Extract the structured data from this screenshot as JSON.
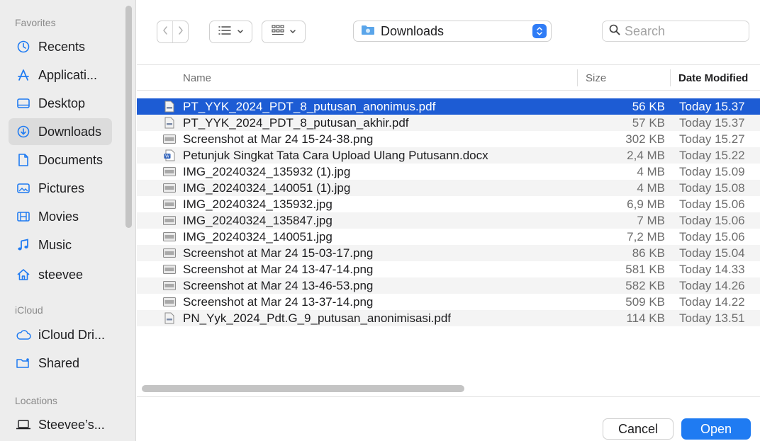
{
  "sidebar": {
    "sections": {
      "favorites": "Favorites",
      "icloud": "iCloud",
      "locations": "Locations"
    },
    "favorites": [
      {
        "label": "Recents",
        "icon": "clock-icon"
      },
      {
        "label": "Applicati...",
        "icon": "applications-icon"
      },
      {
        "label": "Desktop",
        "icon": "desktop-icon"
      },
      {
        "label": "Downloads",
        "icon": "download-icon",
        "active": true
      },
      {
        "label": "Documents",
        "icon": "document-icon"
      },
      {
        "label": "Pictures",
        "icon": "pictures-icon"
      },
      {
        "label": "Movies",
        "icon": "film-icon"
      },
      {
        "label": "Music",
        "icon": "music-note-icon"
      },
      {
        "label": "steevee",
        "icon": "home-icon"
      }
    ],
    "icloud": [
      {
        "label": "iCloud Dri...",
        "icon": "cloud-icon"
      },
      {
        "label": "Shared",
        "icon": "shared-folder-icon"
      }
    ],
    "locations": [
      {
        "label": "Steevee’s...",
        "icon": "laptop-icon"
      }
    ]
  },
  "toolbar": {
    "path_label": "Downloads",
    "search_placeholder": "Search"
  },
  "columns": {
    "name": "Name",
    "size": "Size",
    "date": "Date Modified"
  },
  "files": [
    {
      "name": "PT_YYK_2024_PDT_8_putusan_anonimus.pdf",
      "size": "56 KB",
      "date": "Today 15.37",
      "icon": "pdf-file-icon"
    },
    {
      "name": "PT_YYK_2024_PDT_8_putusan_akhir.pdf",
      "size": "57 KB",
      "date": "Today 15.37",
      "icon": "pdf-file-icon"
    },
    {
      "name": "Screenshot at Mar 24 15-24-38.png",
      "size": "302 KB",
      "date": "Today 15.27",
      "icon": "image-file-icon"
    },
    {
      "name": "Petunjuk Singkat Tata Cara Upload Ulang Putusann.docx",
      "size": "2,4 MB",
      "date": "Today 15.22",
      "icon": "word-file-icon"
    },
    {
      "name": "IMG_20240324_135932 (1).jpg",
      "size": "4 MB",
      "date": "Today 15.09",
      "icon": "image-file-icon"
    },
    {
      "name": "IMG_20240324_140051 (1).jpg",
      "size": "4 MB",
      "date": "Today 15.08",
      "icon": "image-file-icon"
    },
    {
      "name": "IMG_20240324_135932.jpg",
      "size": "6,9 MB",
      "date": "Today 15.06",
      "icon": "image-file-icon"
    },
    {
      "name": "IMG_20240324_135847.jpg",
      "size": "7 MB",
      "date": "Today 15.06",
      "icon": "image-file-icon"
    },
    {
      "name": "IMG_20240324_140051.jpg",
      "size": "7,2 MB",
      "date": "Today 15.06",
      "icon": "image-file-icon"
    },
    {
      "name": "Screenshot at Mar 24 15-03-17.png",
      "size": "86 KB",
      "date": "Today 15.04",
      "icon": "image-file-icon"
    },
    {
      "name": "Screenshot at Mar 24 13-47-14.png",
      "size": "581 KB",
      "date": "Today 14.33",
      "icon": "image-file-icon"
    },
    {
      "name": "Screenshot at Mar 24 13-46-53.png",
      "size": "582 KB",
      "date": "Today 14.26",
      "icon": "image-file-icon"
    },
    {
      "name": "Screenshot at Mar 24 13-37-14.png",
      "size": "509 KB",
      "date": "Today 14.22",
      "icon": "image-file-icon"
    },
    {
      "name": "PN_Yyk_2024_Pdt.G_9_putusan_anonimisasi.pdf",
      "size": "114 KB",
      "date": "Today 13.51",
      "icon": "pdf-file-icon"
    }
  ],
  "buttons": {
    "cancel": "Cancel",
    "open": "Open"
  },
  "colors": {
    "accent": "#1f7bf2",
    "selection": "#1d5cd4",
    "sidebar_bg": "#ededed"
  }
}
